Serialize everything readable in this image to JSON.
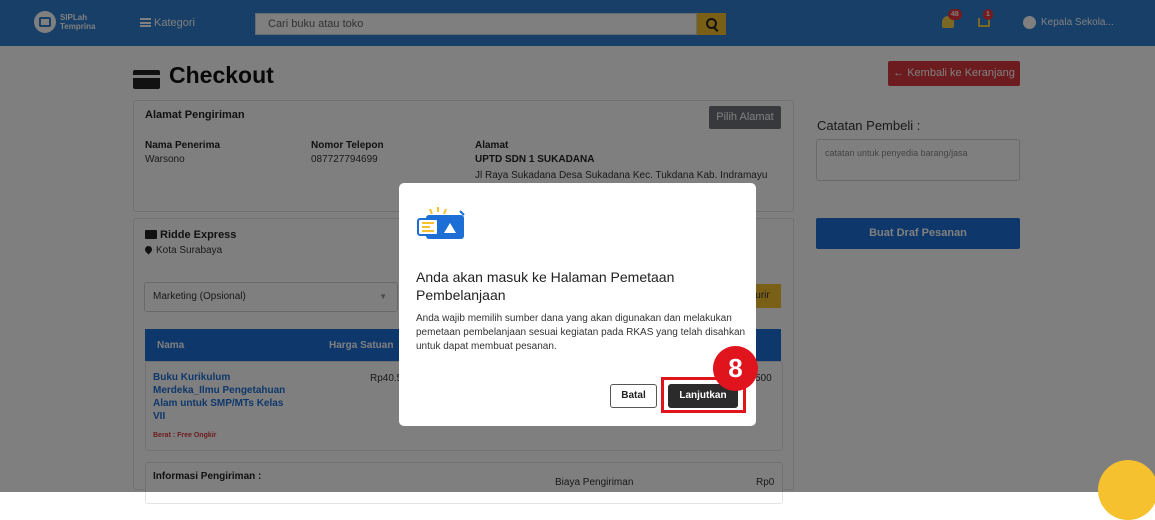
{
  "navbar": {
    "logo_line1": "SIPLah",
    "logo_line2": "Temprina",
    "kategori": "Kategori",
    "search_placeholder": "Cari buku atau toko",
    "notif_count": "48",
    "cart_count": "1",
    "user": "Kepala Sekola..."
  },
  "page": {
    "title": "Checkout",
    "back_button": "Kembali ke Keranjang",
    "alamat": {
      "heading": "Alamat Pengiriman",
      "pilih_button": "Pilih Alamat",
      "nama_label": "Nama Penerima",
      "nama_value": "Warsono",
      "telp_label": "Nomor Telepon",
      "telp_value": "087727794699",
      "alamat_label": "Alamat",
      "alamat_name": "UPTD SDN 1 SUKADANA",
      "alamat_value": "Jl Raya Sukadana Desa Sukadana Kec. Tukdana Kab. Indramayu"
    },
    "toko": {
      "name": "Ridde Express",
      "city": "Kota Surabaya",
      "marketing_select": "Marketing (Opsional)",
      "kurir_button": "urir"
    },
    "table": {
      "headers": [
        "Nama",
        "Harga Satuan"
      ],
      "product": "Buku Kurikulum Merdeka_Ilmu Pengetahuan Alam untuk SMP/MTs Kelas VII",
      "berat": "Berat : Free Ongkir",
      "harga": "Rp40.5",
      "total_partial": "500"
    },
    "shipping": {
      "label": "Informasi Pengiriman :",
      "biaya_label": "Biaya Pengiriman",
      "biaya_value": "Rp0"
    },
    "catatan": {
      "label": "Catatan Pembeli :",
      "placeholder": "catatan untuk penyedia barang/jasa"
    },
    "draf_button": "Buat Draf Pesanan"
  },
  "modal": {
    "title": "Anda akan masuk ke Halaman Pemetaan Pembelanjaan",
    "body": "Anda wajib memilih sumber dana yang akan digunakan dan melakukan pemetaan pembelanjaan sesuai kegiatan pada RKAS yang telah disahkan untuk dapat membuat pesanan.",
    "batal": "Batal",
    "lanjutkan": "Lanjutkan"
  },
  "annotation": {
    "step": "8"
  },
  "colors": {
    "primary": "#1d6fd6",
    "navbar": "#2f7fd1",
    "danger": "#d9393f",
    "accent": "#f5c12f",
    "highlight": "#e0141c"
  }
}
